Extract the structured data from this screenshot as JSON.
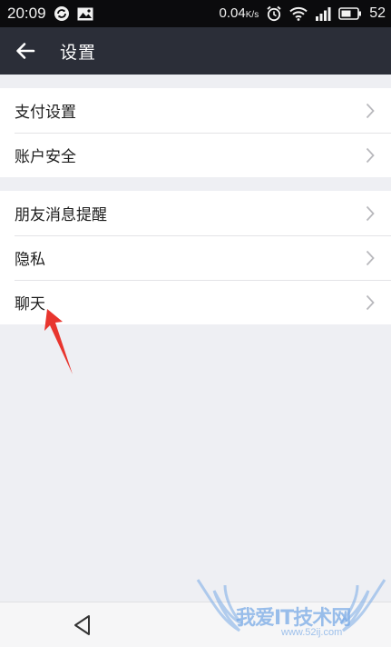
{
  "status_bar": {
    "time": "20:09",
    "net_speed": "0.04",
    "net_unit": "K/s",
    "battery": "52"
  },
  "header": {
    "title": "设置"
  },
  "groups": [
    {
      "items": [
        {
          "label": "支付设置"
        },
        {
          "label": "账户安全"
        }
      ]
    },
    {
      "items": [
        {
          "label": "朋友消息提醒"
        },
        {
          "label": "隐私"
        },
        {
          "label": "聊天"
        }
      ]
    }
  ],
  "watermark": {
    "text": "我爱IT技术网",
    "url": "www.52ij.com"
  },
  "colors": {
    "status_bar_bg": "#0b0b0d",
    "title_bar_bg": "#2b2e38",
    "page_bg": "#eeeff3",
    "annotation_arrow": "#e8352e"
  }
}
